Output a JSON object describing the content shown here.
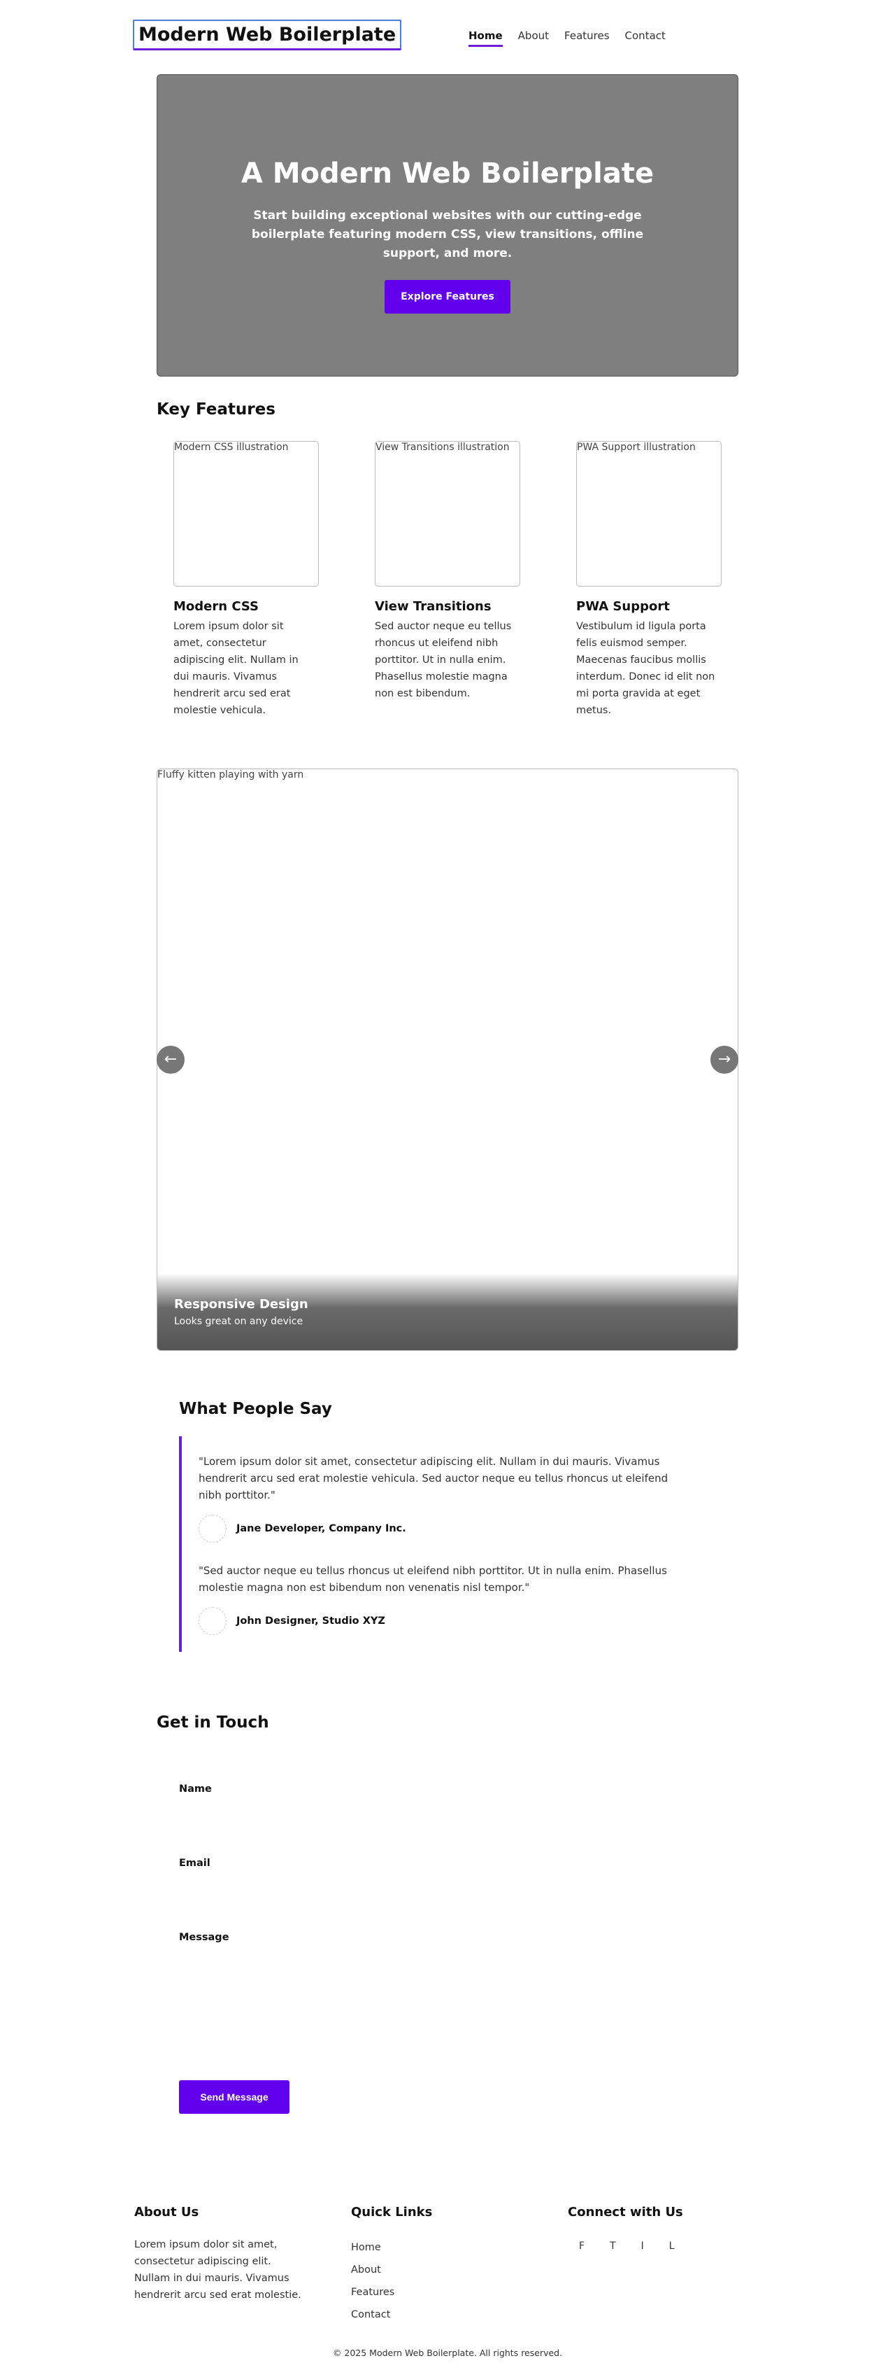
{
  "header": {
    "logo": "Modern Web Boilerplate",
    "nav": [
      "Home",
      "About",
      "Features",
      "Contact"
    ],
    "active_nav": "Home"
  },
  "hero": {
    "title": "A Modern Web Boilerplate",
    "subtitle": "Start building exceptional websites with our cutting-edge boilerplate featuring modern CSS, view transitions, offline support, and more.",
    "cta": "Explore Features"
  },
  "features": {
    "title": "Key Features",
    "items": [
      {
        "image_alt": "Modern CSS illustration",
        "title": "Modern CSS",
        "text": "Lorem ipsum dolor sit amet, consectetur adipiscing elit. Nullam in dui mauris. Vivamus hendrerit arcu sed erat molestie vehicula."
      },
      {
        "image_alt": "View Transitions illustration",
        "title": "View Transitions",
        "text": "Sed auctor neque eu tellus rhoncus ut eleifend nibh porttitor. Ut in nulla enim. Phasellus molestie magna non est bibendum."
      },
      {
        "image_alt": "PWA Support illustration",
        "title": "PWA Support",
        "text": "Vestibulum id ligula porta felis euismod semper. Maecenas faucibus mollis interdum. Donec id elit non mi porta gravida at eget metus."
      }
    ]
  },
  "carousel": {
    "image_alt": "Fluffy kitten playing with yarn",
    "caption_title": "Responsive Design",
    "caption_text": "Looks great on any device",
    "prev": "←",
    "next": "→"
  },
  "testimonials": {
    "title": "What People Say",
    "items": [
      {
        "quote": "\"Lorem ipsum dolor sit amet, consectetur adipiscing elit. Nullam in dui mauris. Vivamus hendrerit arcu sed erat molestie vehicula. Sed auctor neque eu tellus rhoncus ut eleifend nibh porttitor.\"",
        "author": "Jane Developer, Company Inc."
      },
      {
        "quote": "\"Sed auctor neque eu tellus rhoncus ut eleifend nibh porttitor. Ut in nulla enim. Phasellus molestie magna non est bibendum non venenatis nisl tempor.\"",
        "author": "John Designer, Studio XYZ"
      }
    ]
  },
  "contact": {
    "title": "Get in Touch",
    "name_label": "Name",
    "email_label": "Email",
    "message_label": "Message",
    "submit": "Send Message"
  },
  "footer": {
    "about_title": "About Us",
    "about_text": "Lorem ipsum dolor sit amet, consectetur adipiscing elit. Nullam in dui mauris. Vivamus hendrerit arcu sed erat molestie.",
    "links_title": "Quick Links",
    "links": [
      "Home",
      "About",
      "Features",
      "Contact"
    ],
    "social_title": "Connect with Us",
    "social": [
      "F",
      "T",
      "I",
      "L"
    ],
    "copyright": "© 2025 Modern Web Boilerplate. All rights reserved."
  },
  "colors": {
    "accent": "#6200ee",
    "hero_bg": "#7f7f7f",
    "nav_underline": "#6a1fd6"
  }
}
